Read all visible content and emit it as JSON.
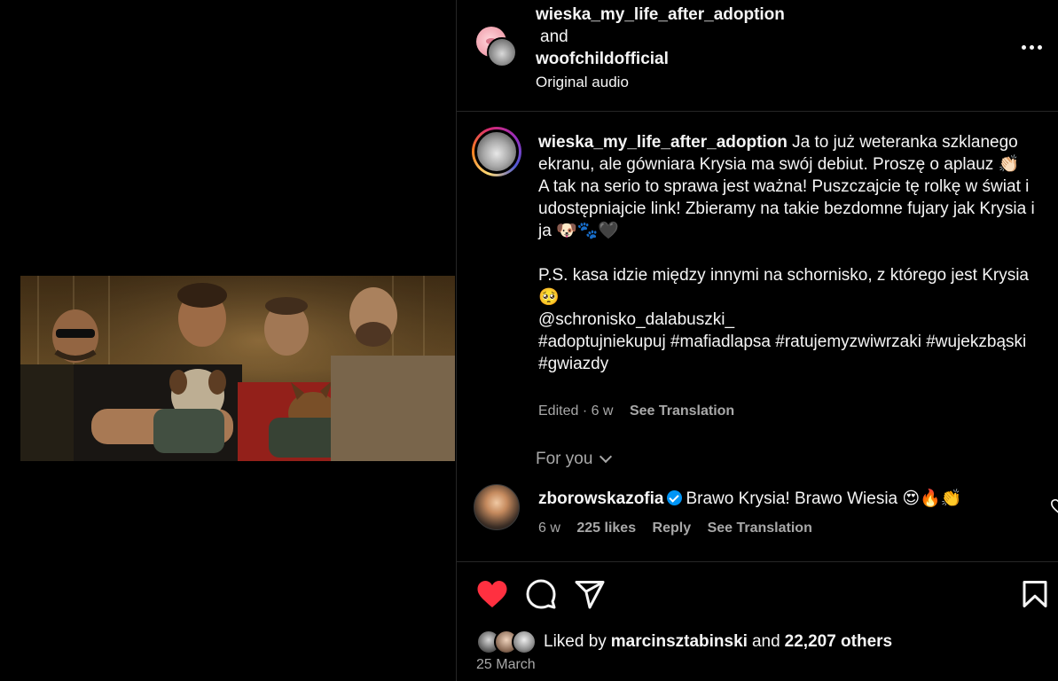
{
  "header": {
    "user1": "wieska_my_life_after_adoption",
    "and": "and",
    "user2": "woofchildofficial",
    "audio": "Original audio"
  },
  "caption": {
    "username": "wieska_my_life_after_adoption",
    "line1": "Ja to już weteranka szklanego ekranu, ale gówniara Krysia ma swój debiut. Proszę o aplauz 👏🏻",
    "line2": "A tak na serio to sprawa jest ważna! Puszczajcie tę rolkę w świat i udostępniajcie link! Zbieramy na takie bezdomne fujary jak Krysia i ja 🐶🐾🖤",
    "line3": "P.S. kasa idzie między innymi na schornisko, z którego jest Krysia 🥺",
    "mention": "@schronisko_dalabuszki_",
    "hashtags": "#adoptujniekupuj #mafiadlapsa #ratujemyzwiwrzaki #wujekzbąski #gwiazdy",
    "meta_time": "Edited · 6 w",
    "see_translation": "See Translation"
  },
  "for_you": "For you",
  "comment": {
    "username": "zborowskazofia",
    "text": "Brawo Krysia! Brawo Wiesia 😍🔥👏",
    "time": "6 w",
    "likes": "225 likes",
    "reply": "Reply",
    "see_translation": "See Translation"
  },
  "actions": {
    "liked_by_prefix": "Liked by",
    "liked_by_user": "marcinsztabinski",
    "liked_by_and": "and",
    "liked_by_others": "22,207 others",
    "date": "25 March"
  },
  "colors": {
    "background": "#000000",
    "text": "#f5f5f5",
    "muted": "#a8a8a8",
    "like_red": "#ff3040",
    "verified_blue": "#0095f6",
    "divider": "#262626"
  }
}
